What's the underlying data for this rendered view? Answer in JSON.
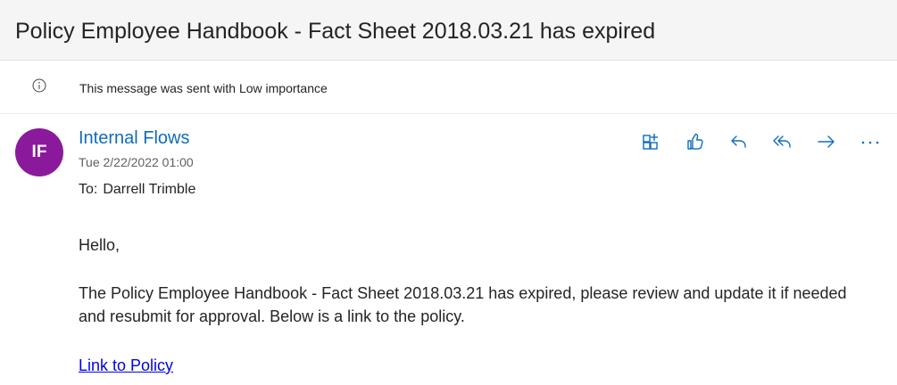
{
  "subject": "Policy Employee Handbook - Fact Sheet 2018.03.21 has expired",
  "importance": {
    "icon": "info-icon",
    "text": "This message was sent with Low importance"
  },
  "message": {
    "avatar_initials": "IF",
    "avatar_color": "#8a1a9b",
    "sender": "Internal Flows",
    "date": "Tue 2/22/2022 01:00",
    "to_label": "To:",
    "to_name": "Darrell Trimble"
  },
  "actions": [
    {
      "icon": "apps-add-icon"
    },
    {
      "icon": "like-icon"
    },
    {
      "icon": "reply-icon"
    },
    {
      "icon": "reply-all-icon"
    },
    {
      "icon": "forward-icon"
    },
    {
      "icon": "more-icon"
    }
  ],
  "body": {
    "greeting": "Hello,",
    "paragraph": "The Policy Employee Handbook - Fact Sheet 2018.03.21 has expired, please review and update it if needed and resubmit for approval. Below is a link to the policy.",
    "link_text": "Link to Policy"
  },
  "colors": {
    "accent": "#0f6cbd",
    "link": "#0000ee"
  }
}
